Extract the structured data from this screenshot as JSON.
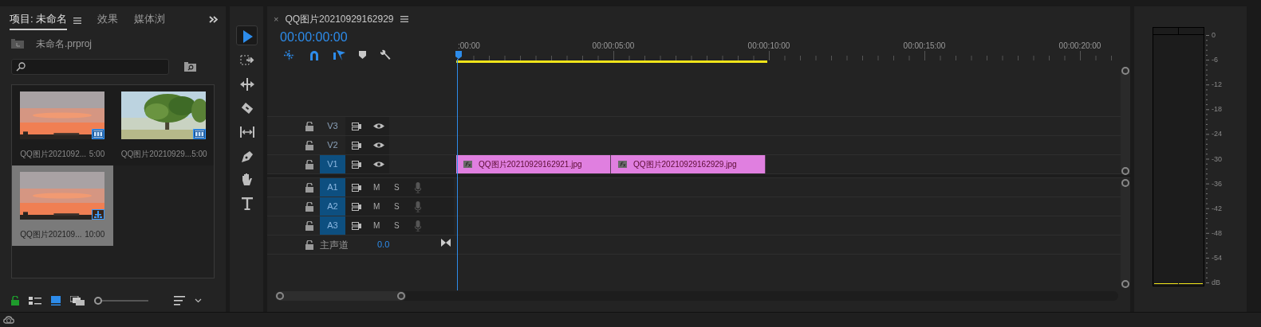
{
  "project_panel": {
    "tabs": [
      {
        "label": "项目: 未命名",
        "selected": true
      },
      {
        "label": "效果",
        "selected": false
      },
      {
        "label": "媒体浏",
        "selected": false
      }
    ],
    "project_file": "未命名.prproj",
    "items": [
      {
        "name": "QQ图片2021092...",
        "duration": "5:00",
        "kind": "clip",
        "selected": false
      },
      {
        "name": "QQ图片20210929...",
        "duration": "5:00",
        "kind": "clip",
        "selected": false
      },
      {
        "name": "QQ图片202109...",
        "duration": "10:00",
        "kind": "sequence",
        "selected": true
      }
    ],
    "zoom_slider": {
      "level": 0
    }
  },
  "tools": [
    {
      "kind": "selection",
      "selected": true
    },
    {
      "kind": "track-select",
      "selected": false
    },
    {
      "kind": "ripple",
      "selected": false
    },
    {
      "kind": "razor",
      "selected": false
    },
    {
      "kind": "slip",
      "selected": false
    },
    {
      "kind": "pen",
      "selected": false
    },
    {
      "kind": "hand",
      "selected": false
    },
    {
      "kind": "type",
      "selected": false
    }
  ],
  "timeline": {
    "close": "×",
    "title": "QQ图片20210929162929",
    "timecode": "00:00:00:00",
    "ruler_labels": [
      ":00:00",
      "00:00:05:00",
      "00:00:10:00",
      "00:00:15:00",
      "00:00:20:00"
    ],
    "tracks": [
      {
        "kind": "video",
        "name": "V3",
        "targeted": false
      },
      {
        "kind": "video",
        "name": "V2",
        "targeted": false
      },
      {
        "kind": "video",
        "name": "V1",
        "targeted": true,
        "clips": [
          {
            "name": "QQ图片20210929162921.jpg"
          },
          {
            "name": "QQ图片20210929162929.jpg"
          }
        ]
      },
      {
        "kind": "audio",
        "name": "A1",
        "targeted": true,
        "mute": "M",
        "solo": "S"
      },
      {
        "kind": "audio",
        "name": "A2",
        "targeted": true,
        "mute": "M",
        "solo": "S"
      },
      {
        "kind": "audio",
        "name": "A3",
        "targeted": true,
        "mute": "M",
        "solo": "S"
      }
    ],
    "master": {
      "label": "主声道",
      "value": "0.0"
    }
  },
  "meter": {
    "scale": [
      "0",
      "-6",
      "-12",
      "-18",
      "-24",
      "-30",
      "-36",
      "-42",
      "-48",
      "-54",
      "dB"
    ]
  }
}
